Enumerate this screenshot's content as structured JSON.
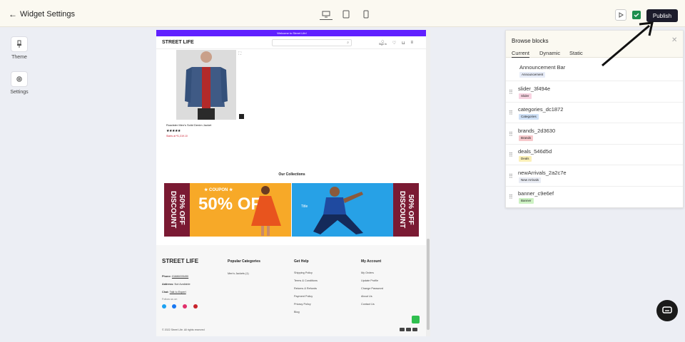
{
  "header": {
    "back_icon": "arrow-left-icon",
    "title": "Widget Settings",
    "devices": [
      "desktop-icon",
      "tablet-icon",
      "mobile-icon"
    ],
    "publish_label": "Publish"
  },
  "sidebar": {
    "items": [
      {
        "label": "Theme",
        "icon": "theme-icon"
      },
      {
        "label": "Settings",
        "icon": "gear-icon"
      }
    ]
  },
  "preview": {
    "announcement": "Welcome to Street Life!",
    "logo": "STREET LIFE",
    "sign_in": "Sign In",
    "product": {
      "name": "Roadster Men's Solid Denim Jacket",
      "price": "Starts at ₹1,319.10",
      "stars": "★★★★★"
    },
    "collections_title": "Our Collections",
    "banner_left": {
      "ticket": "50% OFF DISCOUNT",
      "coupon": "★ COUPON ★",
      "big": "50% OFF"
    },
    "banner_right": {
      "ticket": "50% OFF DISCOUNT",
      "title": "Title"
    },
    "footer": {
      "logo": "STREET LIFE",
      "phone_label": "Phone:",
      "phone": "01686005490",
      "address_label": "Address:",
      "address": "Not Available",
      "chat_label": "Chat:",
      "chat": "Talk to Expert",
      "follow": "Follow us on",
      "popular_title": "Popular Categories",
      "popular": [
        "Men's Jackets (1)"
      ],
      "help_title": "Get Help",
      "help": [
        "Shipping Policy",
        "Terms & Conditions",
        "Returns & Refunds",
        "Payment Policy",
        "Privacy Policy",
        "Blog"
      ],
      "account_title": "My Account",
      "account": [
        "My Orders",
        "Update Profile",
        "Change Password",
        "About Us",
        "Contact Us"
      ],
      "copyright": "© 2022 Street Life. All rights reserved"
    }
  },
  "panel": {
    "title": "Browse blocks",
    "tabs": [
      "Current",
      "Dynamic",
      "Static"
    ],
    "blocks": [
      {
        "name": "Announcement Bar",
        "tag": "Announcement",
        "color": "#e7ecf8"
      },
      {
        "name": "slider_3f494e",
        "tag": "Slider",
        "color": "#f8d3e1"
      },
      {
        "name": "categories_dc1872",
        "tag": "Categories",
        "color": "#cfe1f7"
      },
      {
        "name": "brands_2d3630",
        "tag": "Brands",
        "color": "#f7c9cc"
      },
      {
        "name": "deals_546d5d",
        "tag": "Deals",
        "color": "#fbf0b8"
      },
      {
        "name": "newArrivals_2a2c7e",
        "tag": "New Arrivals",
        "color": "#e9ecf4"
      },
      {
        "name": "banner_c9e6ef",
        "tag": "Banner",
        "color": "#cdf2c3"
      }
    ]
  },
  "colors": {
    "accent": "#1c1c2b",
    "announcement_bg": "#6020ff",
    "success": "#1e8f4e"
  }
}
